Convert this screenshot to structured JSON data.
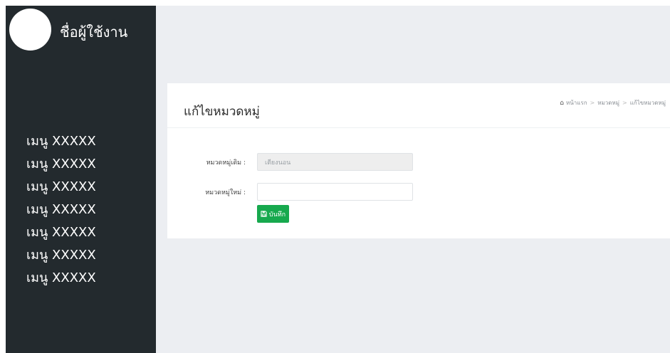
{
  "sidebar": {
    "username": "ชื่อผู้ใช้งาน",
    "menu": [
      {
        "label": "เมนู XXXXX"
      },
      {
        "label": "เมนู XXXXX"
      },
      {
        "label": "เมนู XXXXX"
      },
      {
        "label": "เมนู XXXXX"
      },
      {
        "label": "เมนู XXXXX"
      },
      {
        "label": "เมนู XXXXX"
      },
      {
        "label": "เมนู XXXXX"
      }
    ]
  },
  "panel": {
    "title": "แก้ไขหมวดหมู่",
    "breadcrumb": {
      "home_icon": "home-icon",
      "items": [
        "หน้าแรก",
        "หมวดหมู่",
        "แก้ไขหมวดหมู่"
      ]
    },
    "form": {
      "old_label": "หมวดหมู่เดิม :",
      "old_value": "เตียงนอน",
      "new_label": "หมวดหมู่ใหม่ :",
      "new_value": "",
      "save_label": "บันทึก",
      "save_icon": "floppy-disk-icon"
    }
  },
  "colors": {
    "sidebar_bg": "#232a2e",
    "page_bg": "#eceef2",
    "panel_bg": "#ffffff",
    "save_button": "#17a94e"
  }
}
